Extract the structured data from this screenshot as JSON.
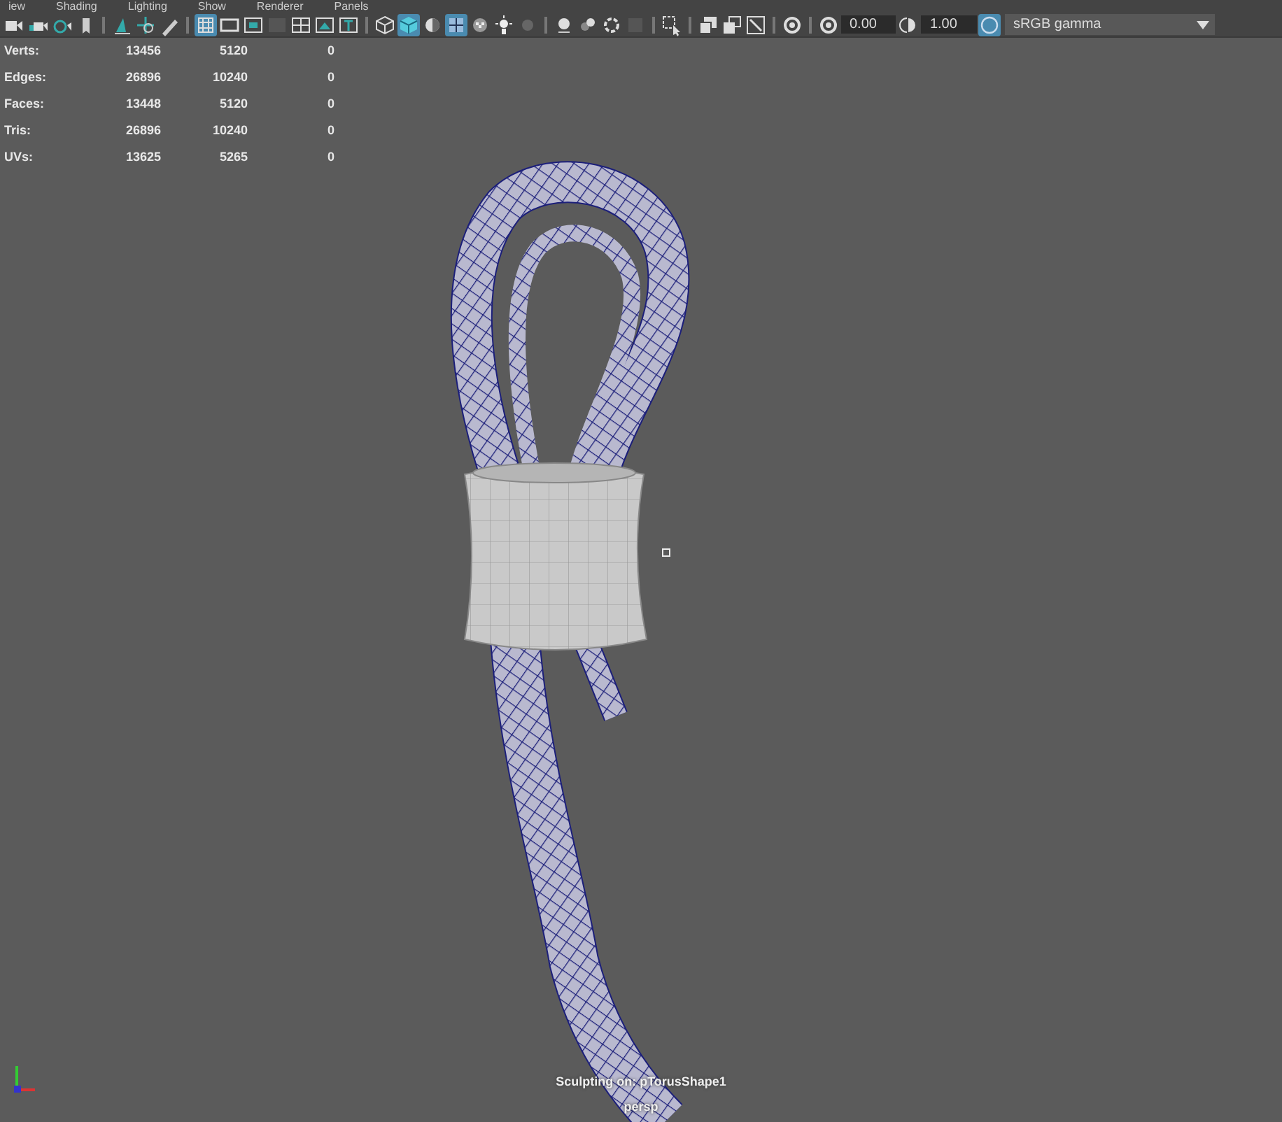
{
  "menu": [
    "iew",
    "Shading",
    "Lighting",
    "Show",
    "Renderer",
    "Panels"
  ],
  "toolbar": [
    {
      "kind": "camera",
      "selected": false
    },
    {
      "kind": "lock-camera",
      "selected": false
    },
    {
      "kind": "camera-attr",
      "selected": false
    },
    {
      "kind": "bookmark",
      "selected": false
    },
    {
      "kind": "sep"
    },
    {
      "kind": "image-plane",
      "selected": false
    },
    {
      "kind": "move",
      "selected": false
    },
    {
      "kind": "pen",
      "selected": false
    },
    {
      "kind": "sep"
    },
    {
      "kind": "grid",
      "selected": true
    },
    {
      "kind": "film-gate",
      "selected": false
    },
    {
      "kind": "resolution-gate",
      "selected": false
    },
    {
      "kind": "gate-mask",
      "selected": false
    },
    {
      "kind": "field-chart",
      "selected": false
    },
    {
      "kind": "safe-action",
      "selected": false
    },
    {
      "kind": "safe-title",
      "selected": false
    },
    {
      "kind": "sep"
    },
    {
      "kind": "wire-cube",
      "selected": false
    },
    {
      "kind": "shaded-cube",
      "selected": true
    },
    {
      "kind": "half-sphere",
      "selected": false
    },
    {
      "kind": "wire-on-shaded",
      "selected": true
    },
    {
      "kind": "checker",
      "selected": false
    },
    {
      "kind": "light",
      "selected": false
    },
    {
      "kind": "dim-sphere",
      "selected": false
    },
    {
      "kind": "sep"
    },
    {
      "kind": "sphere",
      "selected": false
    },
    {
      "kind": "spheres",
      "selected": false
    },
    {
      "kind": "ring",
      "selected": false
    },
    {
      "kind": "square",
      "selected": false
    },
    {
      "kind": "sep"
    },
    {
      "kind": "select-arrow",
      "selected": false
    },
    {
      "kind": "sep"
    },
    {
      "kind": "windows",
      "selected": false
    },
    {
      "kind": "window",
      "selected": false
    },
    {
      "kind": "box-slash",
      "selected": false
    },
    {
      "kind": "sep"
    },
    {
      "kind": "aperture",
      "selected": false
    }
  ],
  "exposure": "0.00",
  "gamma_icon": true,
  "gamma": "1.00",
  "color_management": {
    "on": true
  },
  "view_transform": "sRGB gamma",
  "stats": [
    {
      "label": "Verts:",
      "values": [
        "13456",
        "5120",
        "0"
      ]
    },
    {
      "label": "Edges:",
      "values": [
        "26896",
        "10240",
        "0"
      ]
    },
    {
      "label": "Faces:",
      "values": [
        "13448",
        "5120",
        "0"
      ]
    },
    {
      "label": "Tris:",
      "values": [
        "26896",
        "10240",
        "0"
      ]
    },
    {
      "label": "UVs:",
      "values": [
        "13625",
        "5265",
        "0"
      ]
    }
  ],
  "hud": {
    "sculpt": "Sculpting on: pTorusShape1",
    "camera": "persp"
  }
}
